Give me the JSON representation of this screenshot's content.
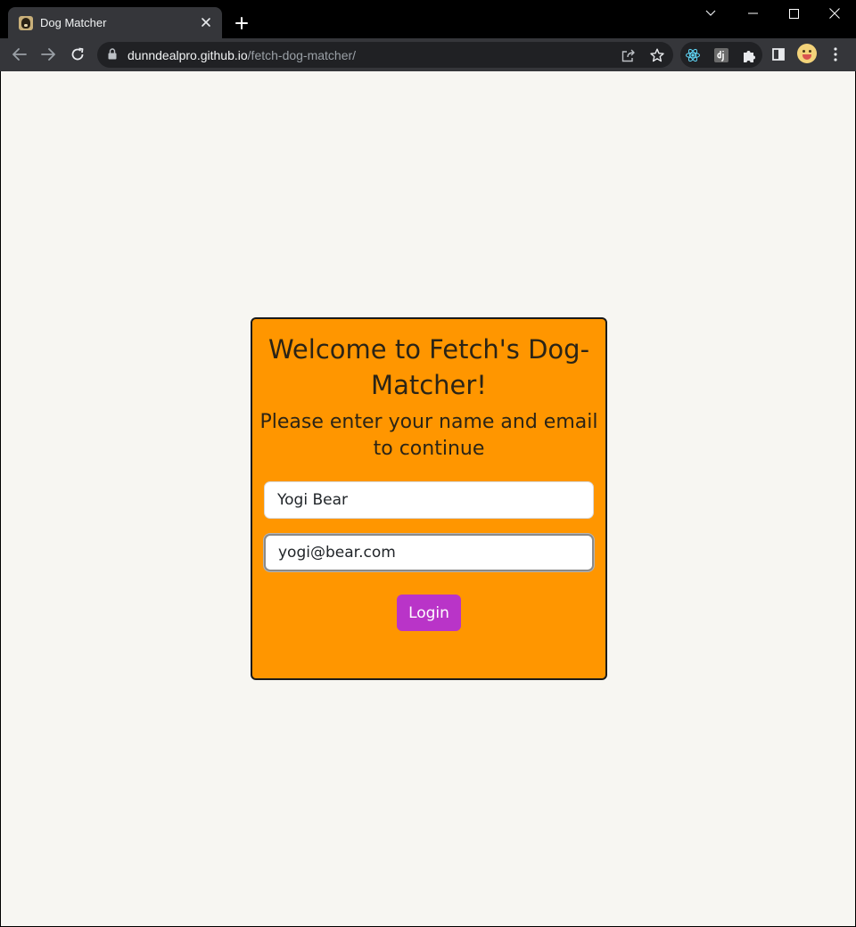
{
  "browser": {
    "tab": {
      "title": "Dog Matcher"
    },
    "address_bar": {
      "host": "dunndealpro.github.io",
      "path": "/fetch-dog-matcher/"
    },
    "extensions": [
      "react-devtools-icon",
      "django-icon",
      "puzzle-icon"
    ],
    "colors": {
      "frame": "#000000",
      "toolbar": "#35363a",
      "omnibox": "#202124"
    }
  },
  "page": {
    "background": "#f7f6f2",
    "card": {
      "background": "#ff9600",
      "title": "Welcome to Fetch's Dog-Matcher!",
      "subtitle": "Please enter your name and email to continue",
      "name_value": "Yogi Bear",
      "email_value": "yogi@bear.com",
      "login_label": "Login",
      "button_color": "#b934c8"
    }
  }
}
